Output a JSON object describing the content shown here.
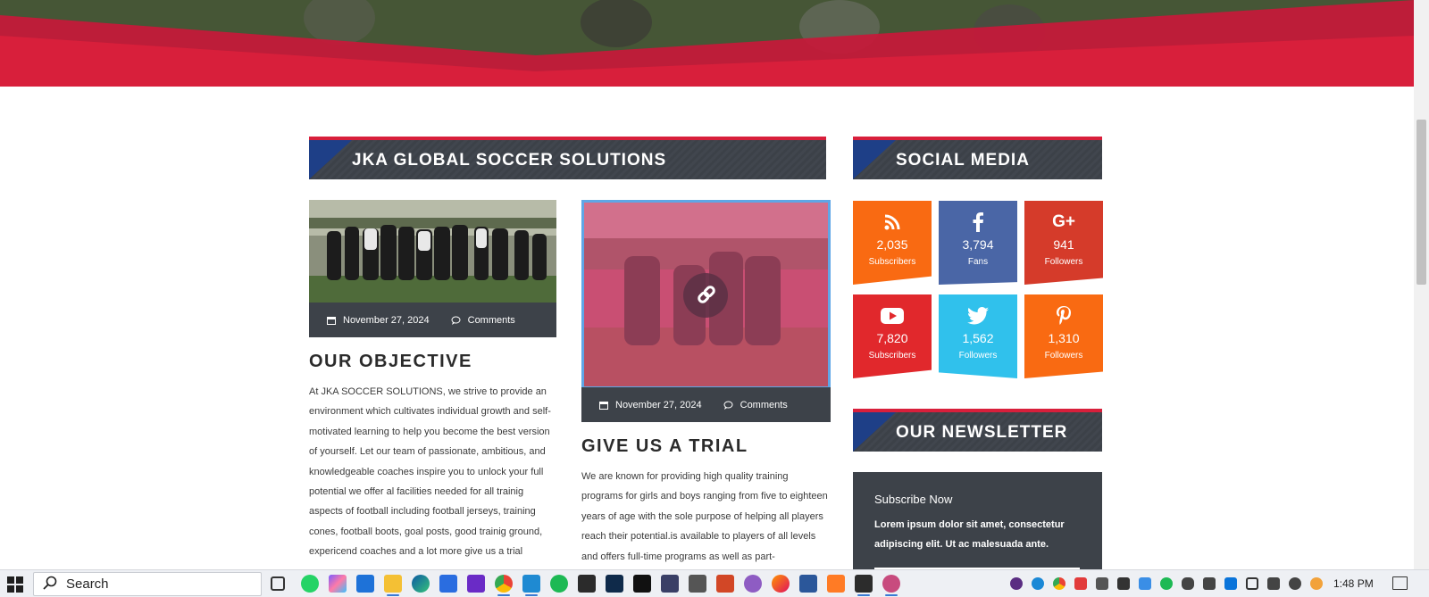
{
  "main": {
    "section_title": "JKA GLOBAL SOCCER SOLUTIONS",
    "posts": [
      {
        "date": "November 27, 2024",
        "comments": "Comments",
        "title": "OUR OBJECTIVE",
        "body": "At JKA SOCCER SOLUTIONS, we strive to provide an environment which cultivates individual growth and self-motivated learning to help you become the best version of yourself. Let our team of passionate, ambitious, and knowledgeable coaches inspire you to unlock your full potential we offer al facilities needed for all trainig aspects of football including football jerseys, training cones, football boots, goal posts, good trainig ground, expericend coaches and a lot more give us a trial"
      },
      {
        "date": "November 27, 2024",
        "comments": "Comments",
        "title": "GIVE US A TRIAL",
        "body": "We are known for providing high quality training programs for girls and boys ranging from five to eighteen years of age with the sole purpose of helping all players reach their potential.is available to players of all levels and offers full-time programs as well as part-"
      }
    ]
  },
  "sidebar": {
    "social_title": "SOCIAL MEDIA",
    "social": [
      {
        "icon": "rss-icon",
        "count": "2,035",
        "label": "Subscribers",
        "color": "#f96a12"
      },
      {
        "icon": "facebook-icon",
        "count": "3,794",
        "label": "Fans",
        "color": "#4a66a6"
      },
      {
        "icon": "google-plus-icon",
        "count": "941",
        "label": "Followers",
        "color": "#d53b2a"
      },
      {
        "icon": "youtube-icon",
        "count": "7,820",
        "label": "Subscribers",
        "color": "#e1282c"
      },
      {
        "icon": "twitter-icon",
        "count": "1,562",
        "label": "Followers",
        "color": "#30c1ec"
      },
      {
        "icon": "pinterest-icon",
        "count": "1,310",
        "label": "Followers",
        "color": "#f96a12"
      }
    ],
    "newsletter_title": "OUR NEWSLETTER",
    "newsletter_subtitle": "Subscribe Now",
    "newsletter_text": "Lorem ipsum dolor sit amet, consectetur adipiscing elit. Ut ac malesuada ante."
  },
  "taskbar": {
    "search_placeholder": "Search",
    "time": "1:48 PM"
  },
  "colors": {
    "accent_red": "#d81f3b",
    "accent_blue": "#1e3f87",
    "header_dark": "#3d4249"
  }
}
